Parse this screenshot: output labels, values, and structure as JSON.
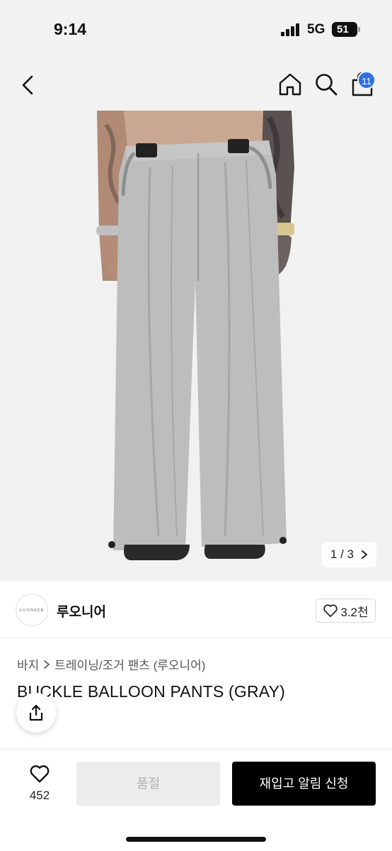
{
  "status_bar": {
    "time": "9:14",
    "network": "5G",
    "battery": "51"
  },
  "nav": {
    "back_icon": "chevron-left-icon",
    "home_icon": "home-icon",
    "search_icon": "search-icon",
    "cart_icon": "cart-icon",
    "cart_badge": "11",
    "badge_color": "#2f6fe0"
  },
  "gallery": {
    "pager": "1 / 3",
    "image_description_icon": "product-photo"
  },
  "brand": {
    "logo_text": "LUONEER",
    "name": "루오니어",
    "likes": "3.2천"
  },
  "breadcrumb": {
    "category": "바지",
    "subcategory": "트레이닝/조거 팬츠 (루오니어)"
  },
  "product": {
    "title": "BUCKLE BALLOON PANTS (GRAY)"
  },
  "bottom_bar": {
    "wish_count": "452",
    "soldout_label": "품절",
    "restock_label": "재입고 알림 신청"
  }
}
